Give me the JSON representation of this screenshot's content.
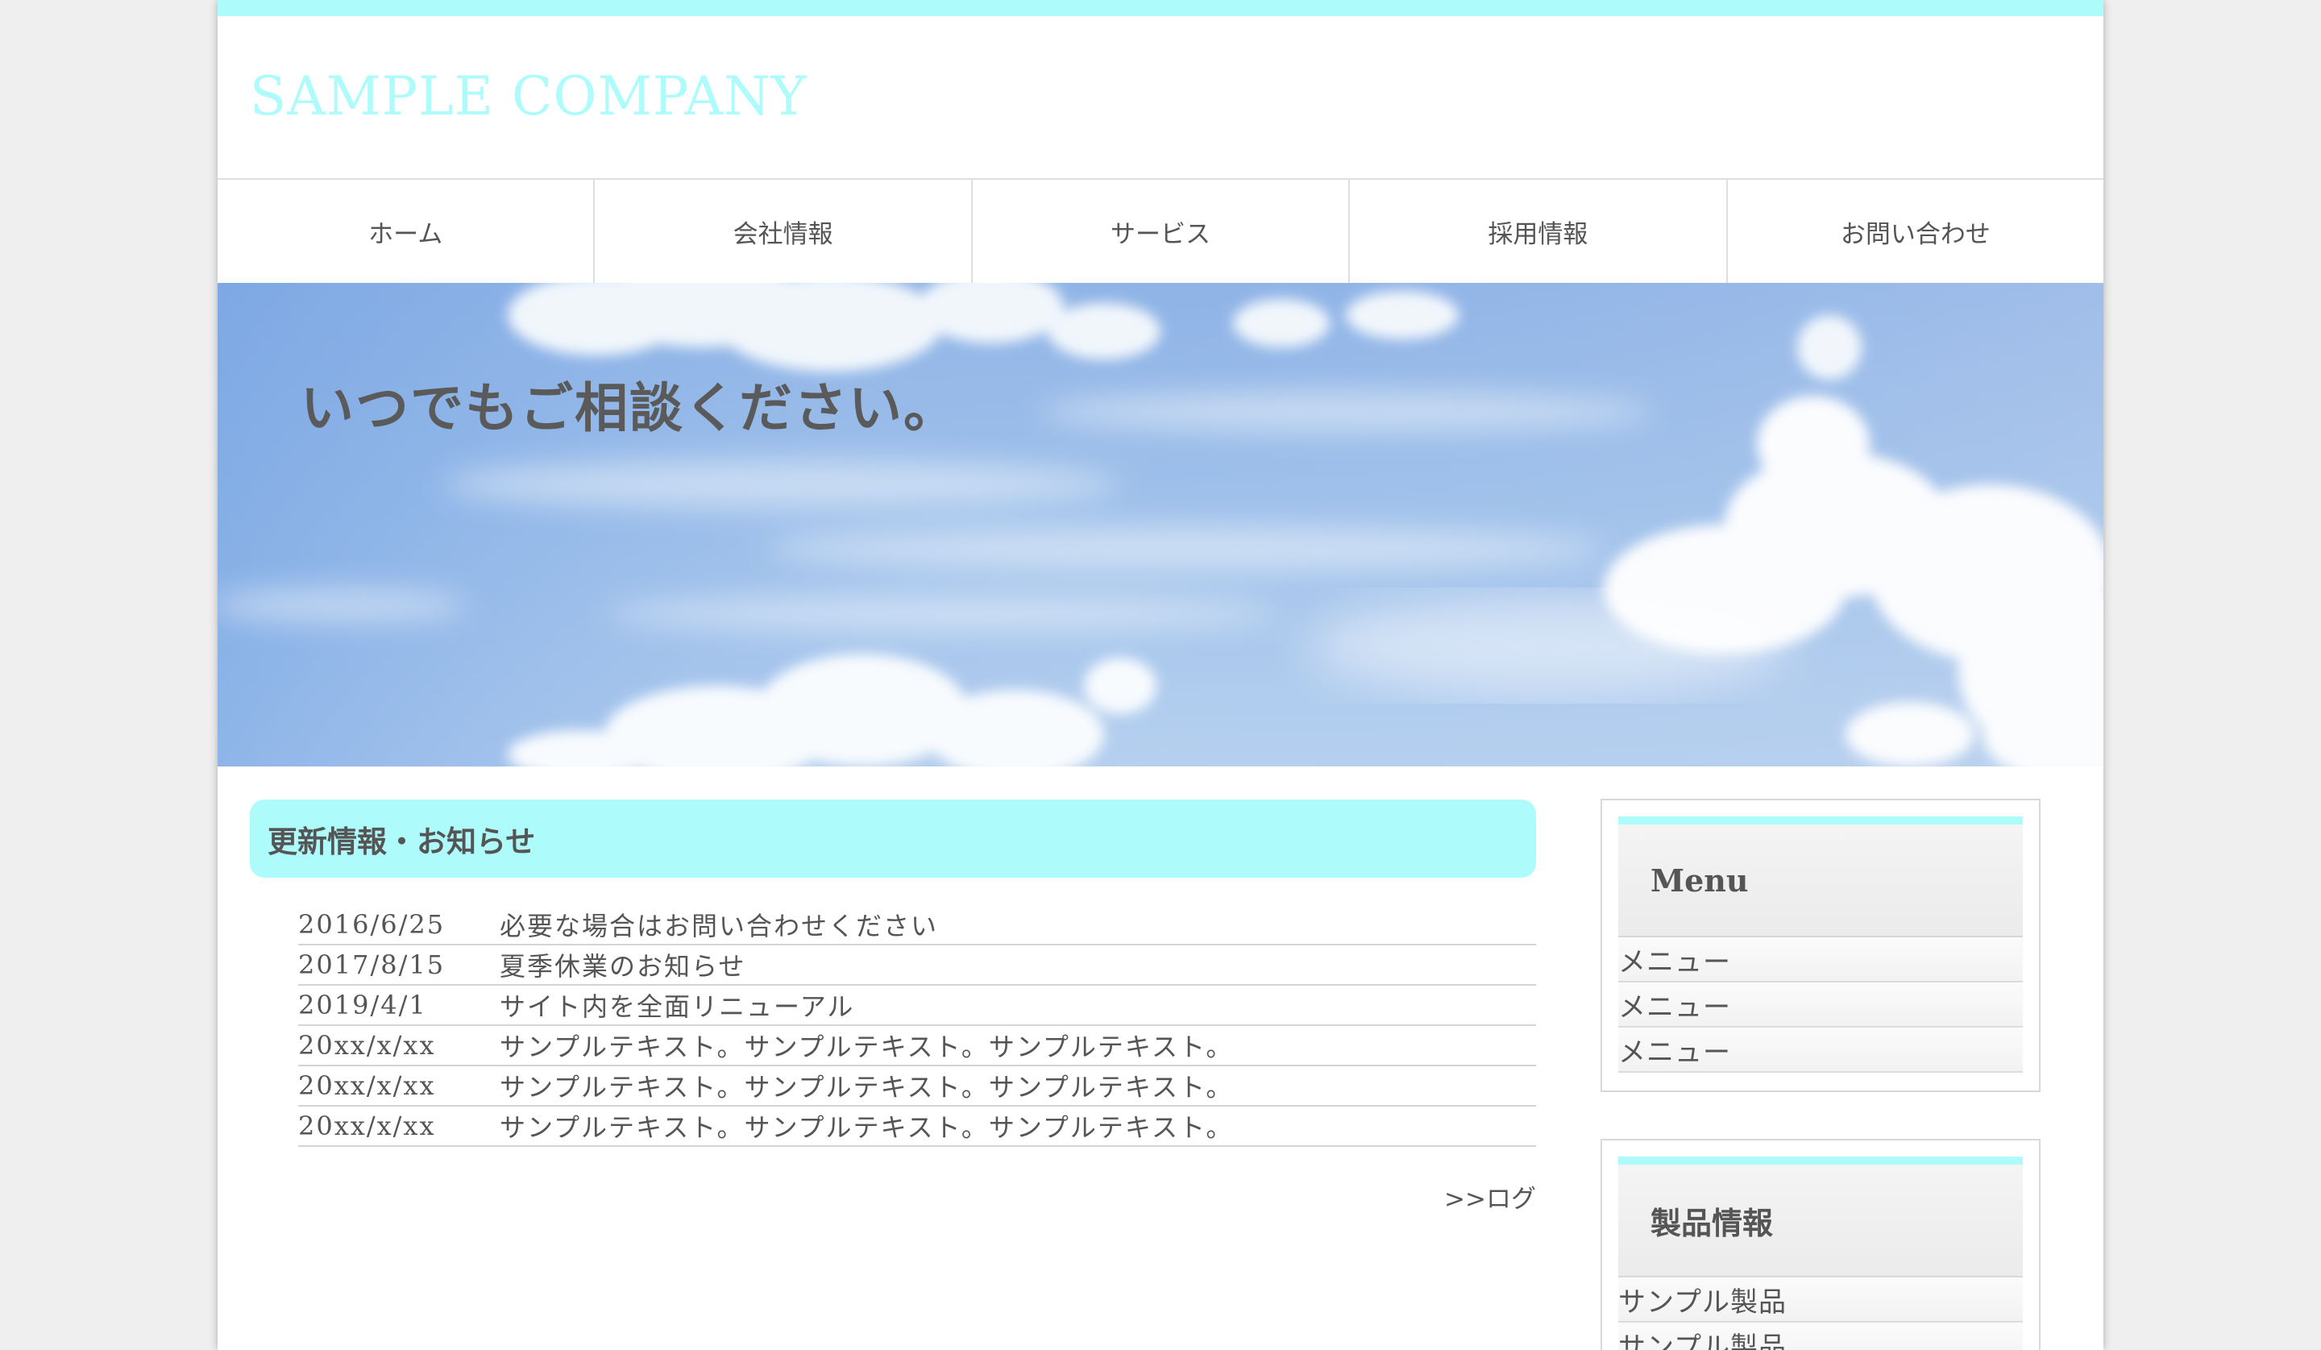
{
  "header": {
    "logo_text": "SAMPLE COMPANY"
  },
  "nav": {
    "items": [
      {
        "label": "ホーム"
      },
      {
        "label": "会社情報"
      },
      {
        "label": "サービス"
      },
      {
        "label": "採用情報"
      },
      {
        "label": "お問い合わせ"
      }
    ]
  },
  "hero": {
    "text": "いつでもご相談ください。"
  },
  "news": {
    "heading": "更新情報・お知らせ",
    "rows": [
      {
        "date": "2016/6/25",
        "text": "必要な場合はお問い合わせください"
      },
      {
        "date": "2017/8/15",
        "text": "夏季休業のお知らせ"
      },
      {
        "date": "2019/4/1",
        "text": "サイト内を全面リニューアル"
      },
      {
        "date": "20xx/x/xx",
        "text": "サンプルテキスト。サンプルテキスト。サンプルテキスト。"
      },
      {
        "date": "20xx/x/xx",
        "text": "サンプルテキスト。サンプルテキスト。サンプルテキスト。"
      },
      {
        "date": "20xx/x/xx",
        "text": "サンプルテキスト。サンプルテキスト。サンプルテキスト。"
      }
    ],
    "more_link": ">>ログ"
  },
  "sidebar": {
    "menu_box": {
      "title": "Menu",
      "items": [
        {
          "label": "メニュー"
        },
        {
          "label": "メニュー"
        },
        {
          "label": "メニュー"
        }
      ]
    },
    "products_box": {
      "title": "製品情報",
      "items": [
        {
          "label": "サンプル製品"
        },
        {
          "label": "サンプル製品"
        }
      ]
    }
  },
  "colors": {
    "accent": "#aefbfc",
    "text": "#555555",
    "page_background": "#efefef"
  }
}
